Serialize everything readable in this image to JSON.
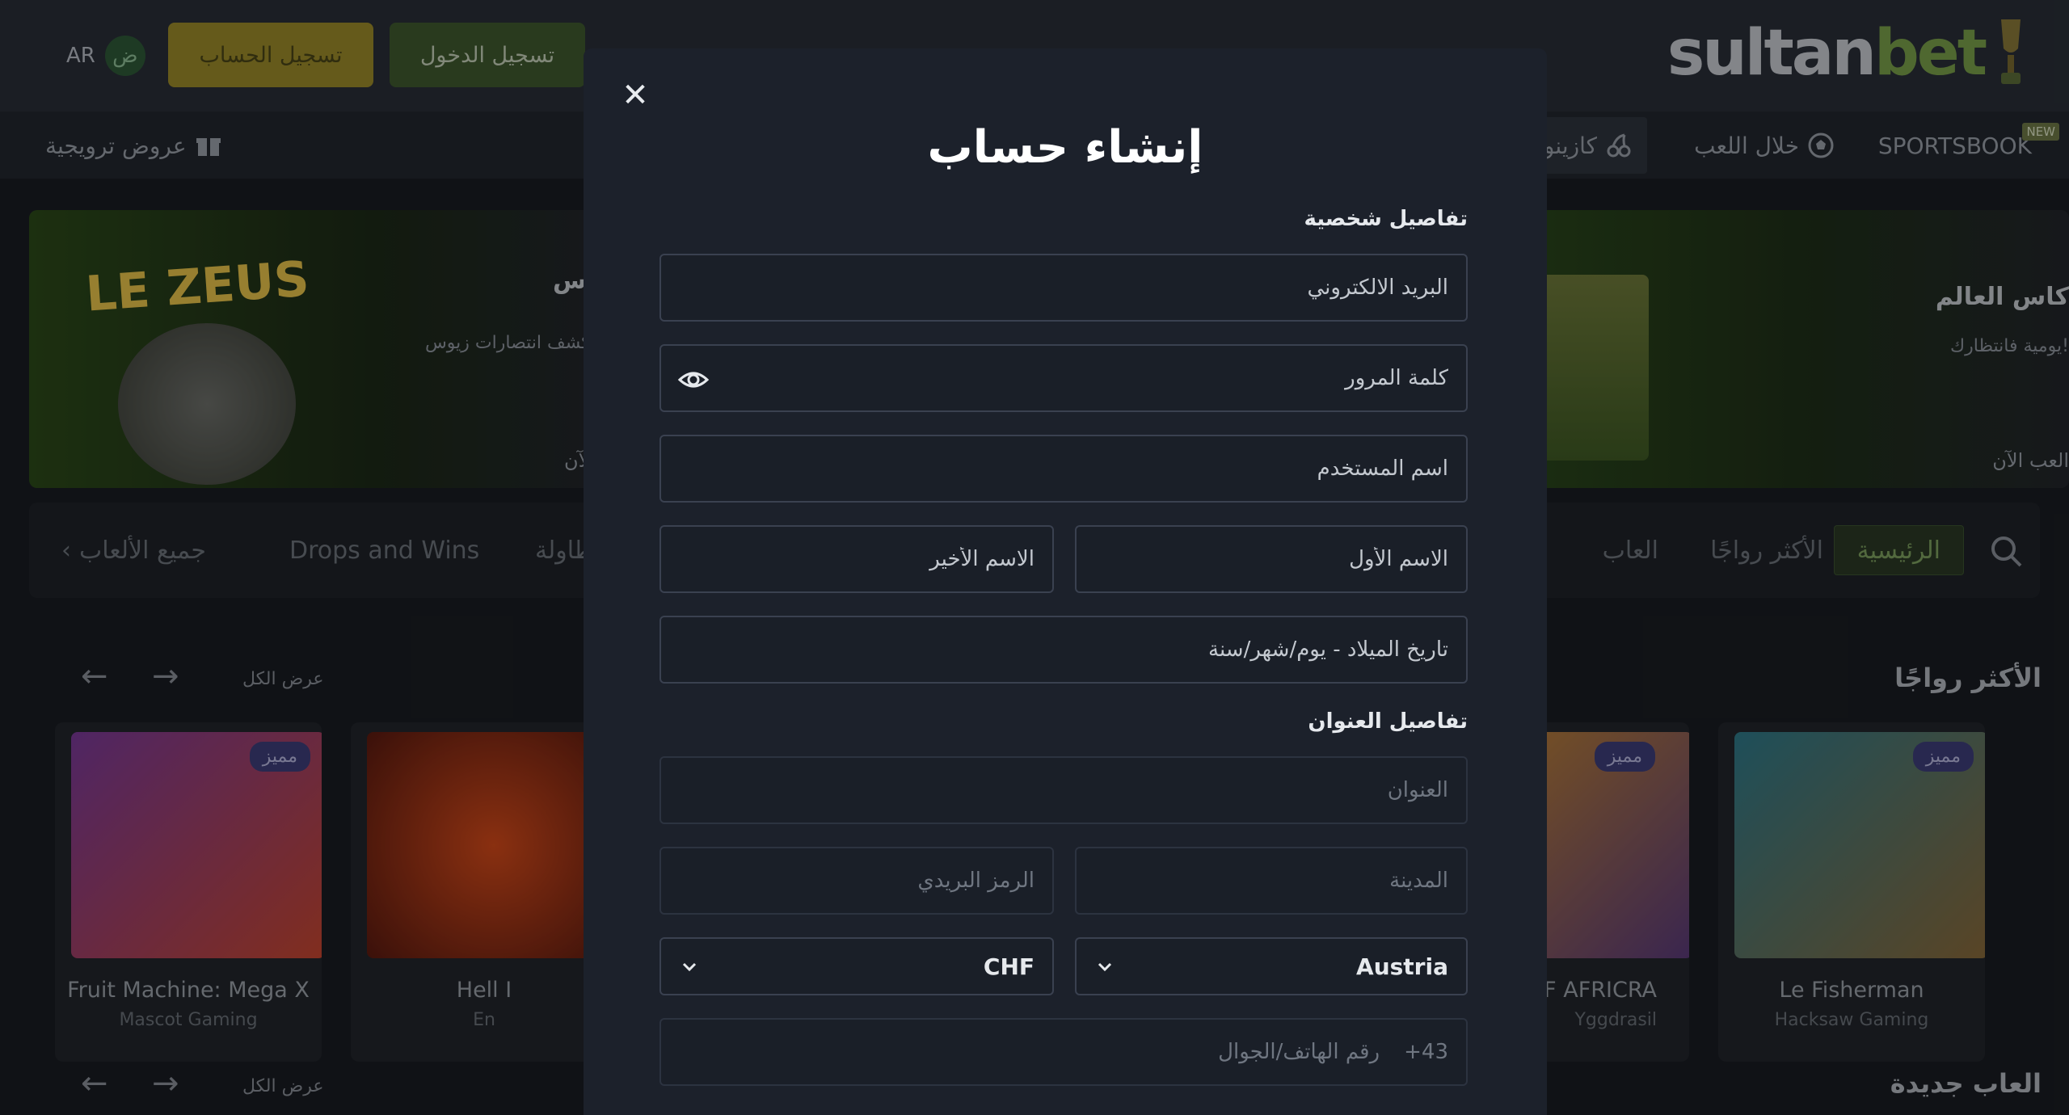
{
  "header": {
    "logo_prefix": "sultan",
    "logo_suffix": "bet",
    "login_label": "تسجيل الدخول",
    "register_label": "تسجيل الحساب",
    "lang_code": "AR",
    "lang_flag_glyph": "ض"
  },
  "nav": {
    "sportsbook": "SPORTSBOOK",
    "new_badge": "NEW",
    "inplay": "خلال اللعب",
    "casino": "كازينو",
    "promotions": "عروض ترويجية"
  },
  "banners": {
    "left": {
      "title": "وس",
      "subtitle": "اكشف انتصارات زيوس",
      "cta": "الآن",
      "logo_text": "LE ZEUS"
    },
    "right": {
      "title": "كاس العالم",
      "subtitle": "يومية فانتظارك!",
      "cta": "العب الآن"
    }
  },
  "categories": {
    "home": "الرئيسية",
    "popular": "الأكثر رواجًا",
    "games": "العاب",
    "table": "طاولة",
    "drops": "Drops and Wins",
    "all_games": "جميع الألعاب"
  },
  "sections": {
    "popular_title": "الأكثر رواجًا",
    "new_games_title": "العاب جديدة",
    "view_all": "عرض الكل"
  },
  "games": [
    {
      "name": "Fruit Machine: Mega X",
      "provider": "Mascot Gaming",
      "badge": "مميز"
    },
    {
      "name": "Hell I",
      "provider": "En",
      "badge": ""
    },
    {
      "name": "OF AFRICRA",
      "provider": "Yggdrasil",
      "badge": "مميز"
    },
    {
      "name": "Le Fisherman",
      "provider": "Hacksaw Gaming",
      "badge": "مميز"
    }
  ],
  "modal": {
    "title": "إنشاء حساب",
    "personal_section": "تفاصيل شخصية",
    "address_section": "تفاصيل العنوان",
    "email_placeholder": "البريد الالكتروني",
    "password_placeholder": "كلمة المرور",
    "username_placeholder": "اسم المستخدم",
    "first_name_placeholder": "الاسم الأول",
    "last_name_placeholder": "الاسم الأخير",
    "dob_placeholder": "تاريخ الميلاد - يوم/شهر/سنة",
    "address_placeholder": "العنوان",
    "city_placeholder": "المدينة",
    "postcode_placeholder": "الرمز البريدي",
    "country_value": "Austria",
    "currency_value": "CHF",
    "phone_prefix": "+43",
    "phone_placeholder": "رقم الهاتف/الجوال"
  },
  "colors": {
    "accent_green": "#3f5a2e",
    "accent_gold": "#9c8a2a",
    "modal_bg": "#1c212b",
    "field_border": "#3a4150"
  }
}
